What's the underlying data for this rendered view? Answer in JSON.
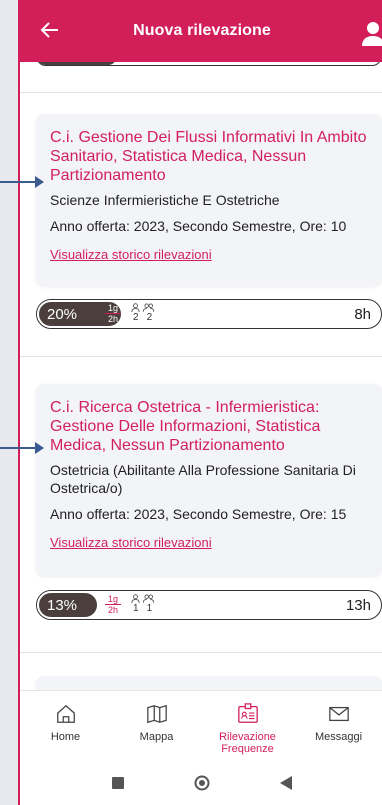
{
  "header": {
    "title": "Nuova rilevazione"
  },
  "cards": [
    {
      "title": "C.i. Gestione Dei Flussi Informativi In Ambito Sanitario, Statistica Medica, Nessun Partizionamento",
      "course": "Scienze Infermieristiche E Ostetriche",
      "offer": "Anno offerta: 2023, Secondo Semestre, Ore: 10",
      "link": "Visualizza storico rilevazioni",
      "progress": {
        "percent_label": "20%",
        "percent": 20,
        "frac_num": "1g",
        "frac_den": "2h",
        "count_a": "2",
        "count_b": "2",
        "hours": "8h"
      }
    },
    {
      "title": "C.i. Ricerca Ostetrica - Infermieristica: Gestione Delle Informazioni, Statistica Medica, Nessun Partizionamento",
      "course": "Ostetricia (Abilitante Alla Professione Sanitaria Di Ostetrica/o)",
      "offer": "Anno offerta: 2023, Secondo Semestre, Ore: 15",
      "link": "Visualizza storico rilevazioni",
      "progress": {
        "percent_label": "13%",
        "percent": 13,
        "frac_num": "1g",
        "frac_den": "2h",
        "count_a": "1",
        "count_b": "1",
        "hours": "13h"
      }
    }
  ],
  "nav": {
    "home": "Home",
    "map": "Mappa",
    "attendance": "Rilevazione Frequenze",
    "messages": "Messaggi"
  },
  "colors": {
    "accent": "#d21f5a",
    "progress_fill": "#4a3f3c",
    "pointer": "#3b5a8f"
  }
}
